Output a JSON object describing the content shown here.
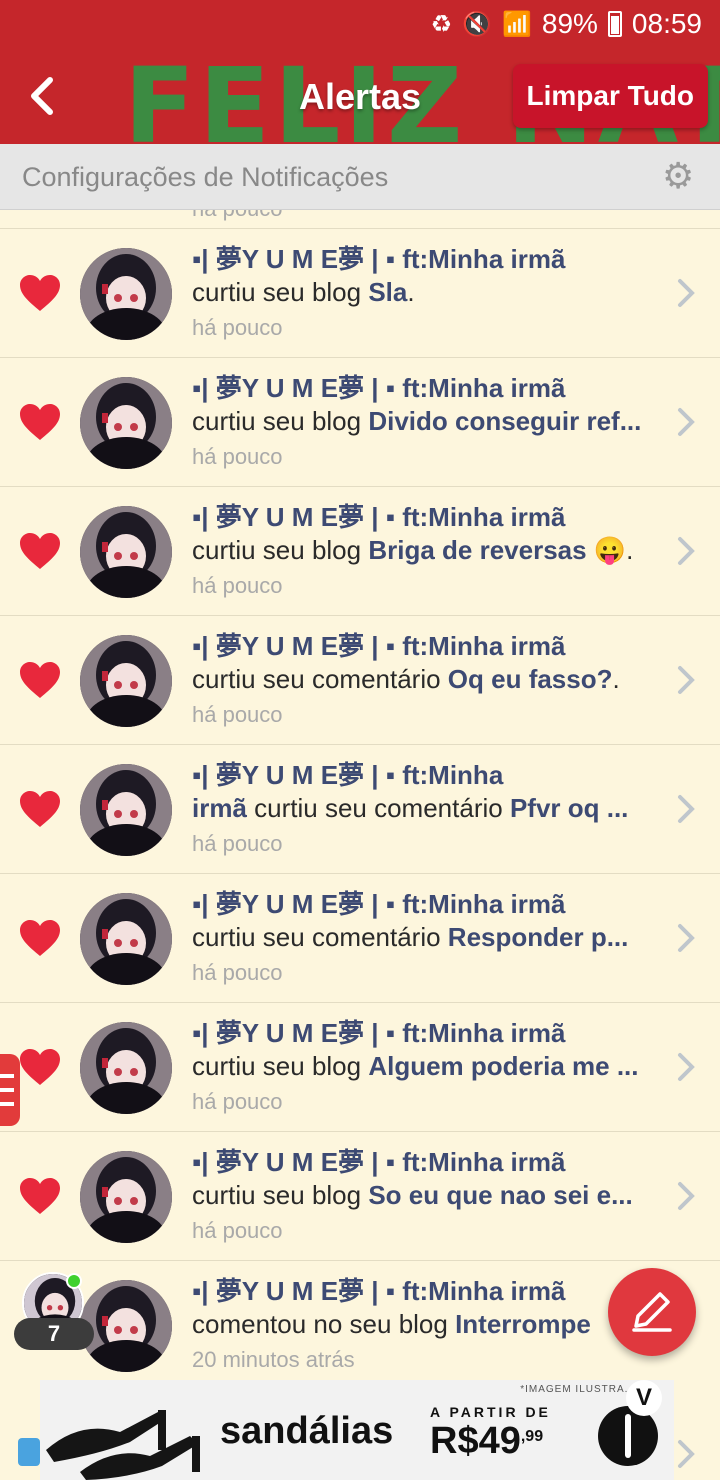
{
  "status_bar": {
    "battery": "89%",
    "time": "08:59",
    "icons": [
      "recycle-icon",
      "mute-icon",
      "wifi-icon",
      "signal-icon",
      "battery-icon"
    ]
  },
  "header": {
    "banner_text": "FELIZ NATAL",
    "title": "Alertas",
    "clear_button": "Limpar Tudo"
  },
  "settings_bar": {
    "label": "Configurações de Notificações"
  },
  "partial_time": "há pouco",
  "notifications": [
    {
      "name": "▪| 夢Y U M E夢 | ▪ ft:Minha irmã",
      "action": "curtiu seu blog ",
      "target": "Sla",
      "suffix": ".",
      "time": "há pouco",
      "icon": "heart-icon"
    },
    {
      "name": "▪| 夢Y U M E夢 | ▪ ft:Minha irmã",
      "action": "curtiu seu blog ",
      "target": "Divido conseguir ref...",
      "suffix": "",
      "time": "há pouco",
      "icon": "heart-icon"
    },
    {
      "name": "▪| 夢Y U M E夢 | ▪ ft:Minha irmã",
      "action": "curtiu seu blog ",
      "target": "Briga de reversas",
      "suffix": " 😛.",
      "time": "há pouco",
      "icon": "heart-icon"
    },
    {
      "name": "▪| 夢Y U M E夢 | ▪ ft:Minha irmã",
      "action": "curtiu seu comentário ",
      "target": "Oq eu fasso?",
      "suffix": ".",
      "time": "há pouco",
      "icon": "heart-icon"
    },
    {
      "name": "▪| 夢Y U M E夢 | ▪ ft:Minha",
      "name_cont": "irmã",
      "action": " curtiu seu comentário ",
      "target": "Pfvr oq ...",
      "suffix": "",
      "time": "há pouco",
      "icon": "heart-icon"
    },
    {
      "name": "▪| 夢Y U M E夢 | ▪ ft:Minha irmã",
      "action": "curtiu seu comentário ",
      "target": "Responder p...",
      "suffix": "",
      "time": "há pouco",
      "icon": "heart-icon"
    },
    {
      "name": "▪| 夢Y U M E夢 | ▪ ft:Minha irmã",
      "action": "curtiu seu blog ",
      "target": "Alguem poderia me ...",
      "suffix": "",
      "time": "há pouco",
      "icon": "heart-icon"
    },
    {
      "name": "▪| 夢Y U M E夢 | ▪ ft:Minha irmã",
      "action": "curtiu seu blog ",
      "target": "So eu que nao sei e...",
      "suffix": "",
      "time": "há pouco",
      "icon": "heart-icon"
    },
    {
      "name": "▪| 夢Y U M E夢 | ▪ ft:Minha irmã",
      "action": "comentou no seu blog ",
      "target": "Interrompe",
      "suffix": "",
      "time": "20 minutos atrás",
      "icon": "none"
    }
  ],
  "floating_user": {
    "count": "7"
  },
  "ad": {
    "disclaimer": "*IMAGEM ILUSTRA...",
    "word": "sandálias",
    "from_label": "A PARTIR DE",
    "price": "R$49",
    "cents": ",99",
    "badge": "V"
  },
  "colors": {
    "header_red": "#c5262b",
    "banner_green": "#3c8b42",
    "row_bg": "#fdf6dd",
    "name_blue": "#3d4a73",
    "heart_red": "#e8283c"
  }
}
